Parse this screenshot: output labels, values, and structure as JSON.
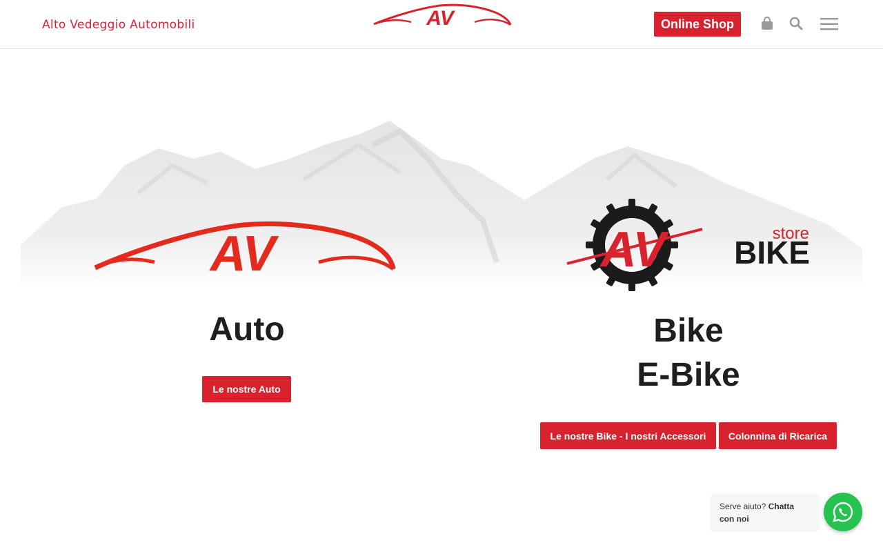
{
  "header": {
    "brand_name": "Alto Vedeggio Automobili",
    "online_shop_label": "Online Shop",
    "icons": [
      "shopping-bag-icon",
      "search-icon",
      "hamburger-menu-icon"
    ]
  },
  "sections": {
    "auto": {
      "title": "Auto",
      "button_label": "Le nostre Auto"
    },
    "bike": {
      "title_line1": "Bike",
      "title_line2": "E-Bike",
      "logo_text_small": "store",
      "logo_text_large": "BIKE",
      "button_bikes_label": "Le nostre Bike - I nostri Accessori",
      "button_charge_label": "Colonnina di Ricarica"
    },
    "logo_letters": "AV"
  },
  "chat": {
    "prefix": "Serve aiuto?",
    "action": "Chatta con noi"
  },
  "colors": {
    "brand_red": "#d8232f",
    "logo_red": "#e42a1c",
    "whatsapp_green": "#25c24f",
    "title_dark": "#1f1f1f"
  }
}
